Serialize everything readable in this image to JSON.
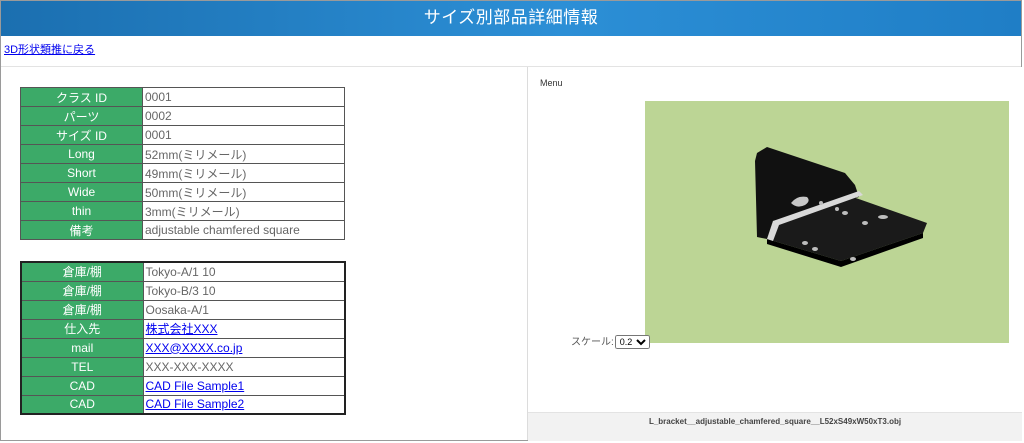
{
  "header": {
    "title": "サイズ別部品詳細情報"
  },
  "nav": {
    "back_link": "3D形状類推に戻る"
  },
  "spec_table": [
    {
      "key": "クラス ID",
      "value": "0001"
    },
    {
      "key": "パーツ",
      "value": "0002"
    },
    {
      "key": "サイズ ID",
      "value": "0001"
    },
    {
      "key": "Long",
      "value": "52mm(ミリメール)"
    },
    {
      "key": "Short",
      "value": "49mm(ミリメール)"
    },
    {
      "key": "Wide",
      "value": "50mm(ミリメール)"
    },
    {
      "key": "thin",
      "value": "3mm(ミリメール)"
    },
    {
      "key": "備考",
      "value": "adjustable chamfered square"
    }
  ],
  "stock_table": [
    {
      "key": "倉庫/棚",
      "value": "Tokyo-A/1 10"
    },
    {
      "key": "倉庫/棚",
      "value": "Tokyo-B/3 10"
    },
    {
      "key": "倉庫/棚",
      "value": "Oosaka-A/1"
    },
    {
      "key": "仕入先",
      "value": "株式会社XXX"
    },
    {
      "key": "mail",
      "value": "XXX@XXXX.co.jp"
    },
    {
      "key": "TEL",
      "value": "XXX-XXX-XXXX"
    },
    {
      "key": "CAD",
      "value": "CAD File Sample1"
    },
    {
      "key": "CAD",
      "value": "CAD File Sample2"
    }
  ],
  "viewer": {
    "menu_label": "Menu",
    "scale_label": "スケール:",
    "scale_value": "0.2",
    "filename": "L_bracket__adjustable_chamfered_square__L52xS49xW50xT3.obj",
    "background_color": "#bcd595"
  }
}
